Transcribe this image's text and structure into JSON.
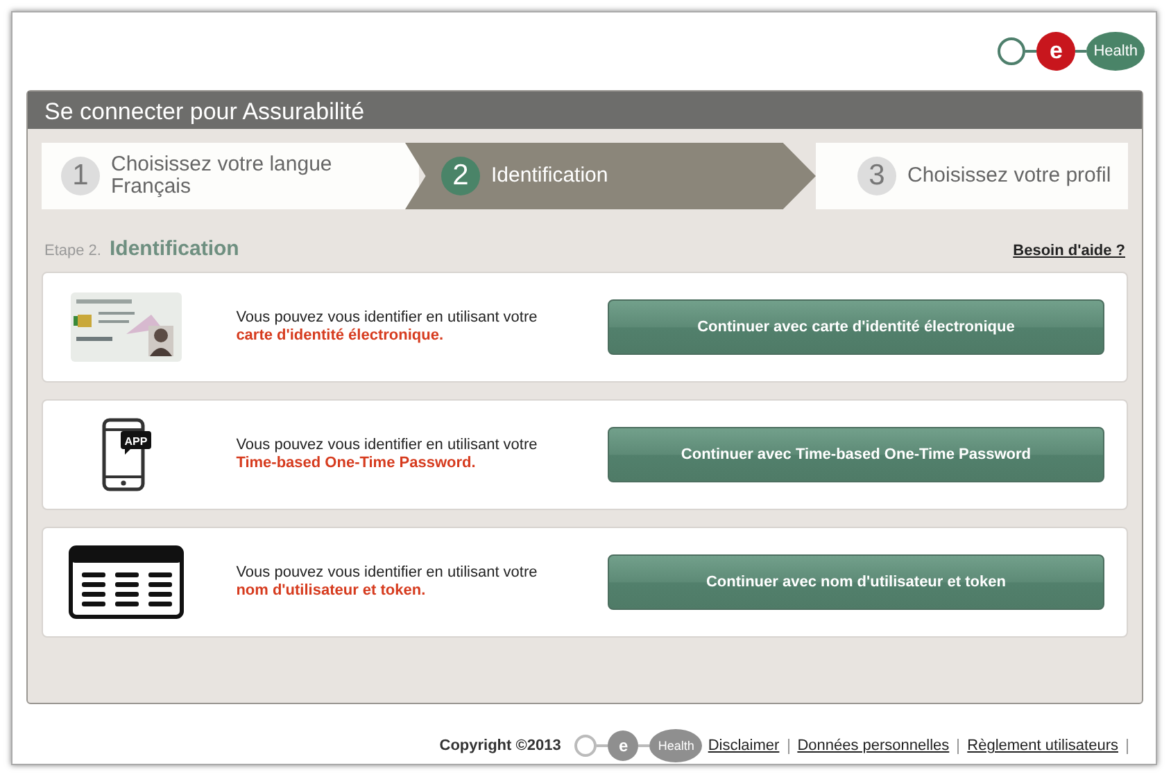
{
  "logo": {
    "letter": "e",
    "word": "Health"
  },
  "panel": {
    "title": "Se connecter pour Assurabilité"
  },
  "steps": [
    {
      "number": "1",
      "label": "Choisissez votre langue",
      "sublabel": "Français",
      "selected": false
    },
    {
      "number": "2",
      "label": "Identification",
      "selected": true
    },
    {
      "number": "3",
      "label": "Choisissez votre profil",
      "selected": false
    }
  ],
  "section": {
    "step": "Etape 2.",
    "title": "Identification",
    "help_link": "Besoin d'aide ?"
  },
  "options": [
    {
      "kind": "id-card",
      "intro": "Vous pouvez vous identifier en utilisant votre",
      "method": "carte d'identité électronique.",
      "button": "Continuer avec carte d'identité électronique"
    },
    {
      "kind": "phone-app",
      "icon_text": "APP",
      "intro": "Vous pouvez vous identifier en utilisant votre",
      "method": "Time-based One-Time Password.",
      "button": "Continuer avec Time-based One-Time Password"
    },
    {
      "kind": "token",
      "intro": "Vous pouvez vous identifier en utilisant votre",
      "method": "nom d'utilisateur et token.",
      "button": "Continuer avec nom d'utilisateur et token"
    }
  ],
  "footer": {
    "copyright": "Copyright ©2013",
    "logo": {
      "letter": "e",
      "word": "Health"
    },
    "links": [
      "Disclaimer",
      "Données personnelles",
      "Règlement utilisateurs"
    ]
  }
}
